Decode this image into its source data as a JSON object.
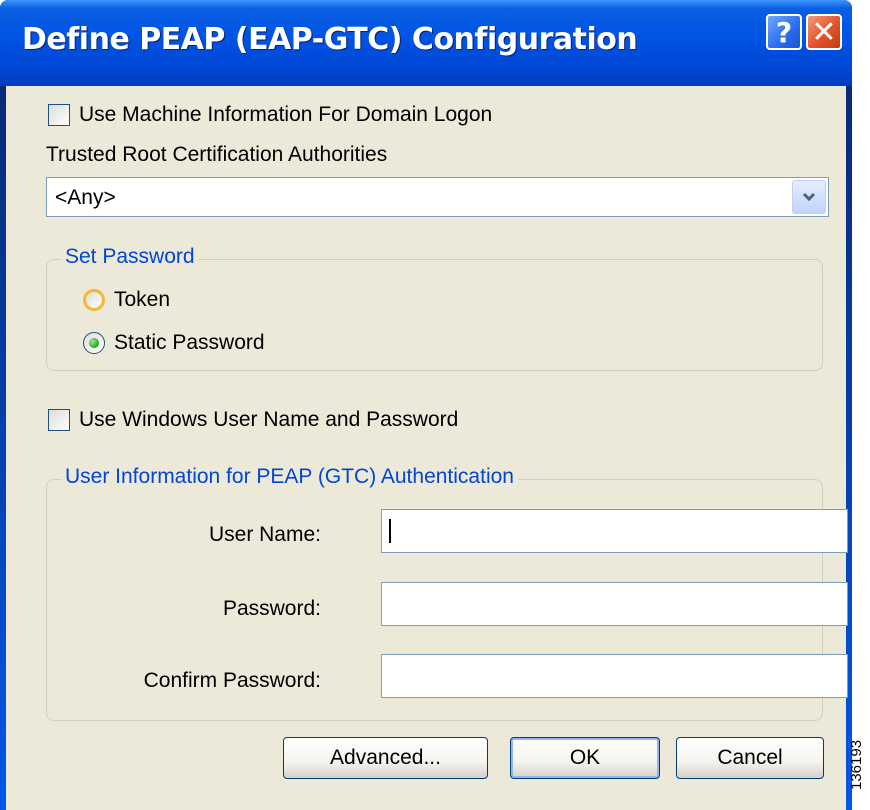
{
  "window": {
    "title": "Define PEAP (EAP-GTC) Configuration",
    "help_glyph": "?",
    "close_glyph": "✕"
  },
  "machine_info": {
    "label": "Use Machine Information For Domain Logon",
    "checked": false
  },
  "trusted_root": {
    "label": "Trusted Root Certification Authorities",
    "selected": "<Any>"
  },
  "set_password": {
    "legend": "Set Password",
    "options": [
      {
        "label": "Token",
        "selected": false
      },
      {
        "label": "Static Password",
        "selected": true
      }
    ]
  },
  "windows_user": {
    "label": "Use Windows User Name and Password",
    "checked": false
  },
  "user_info": {
    "legend": "User Information for PEAP (GTC) Authentication",
    "username_label": "User Name:",
    "username_value": "",
    "password_label": "Password:",
    "password_value": "",
    "confirm_label": "Confirm Password:",
    "confirm_value": ""
  },
  "buttons": {
    "advanced": "Advanced...",
    "ok": "OK",
    "cancel": "Cancel"
  },
  "figure_id": "136193",
  "colors": {
    "title_bar": "#0055e5",
    "dialog_bg": "#ece9d8",
    "legend_text": "#0046d5",
    "close": "#e2532b"
  }
}
